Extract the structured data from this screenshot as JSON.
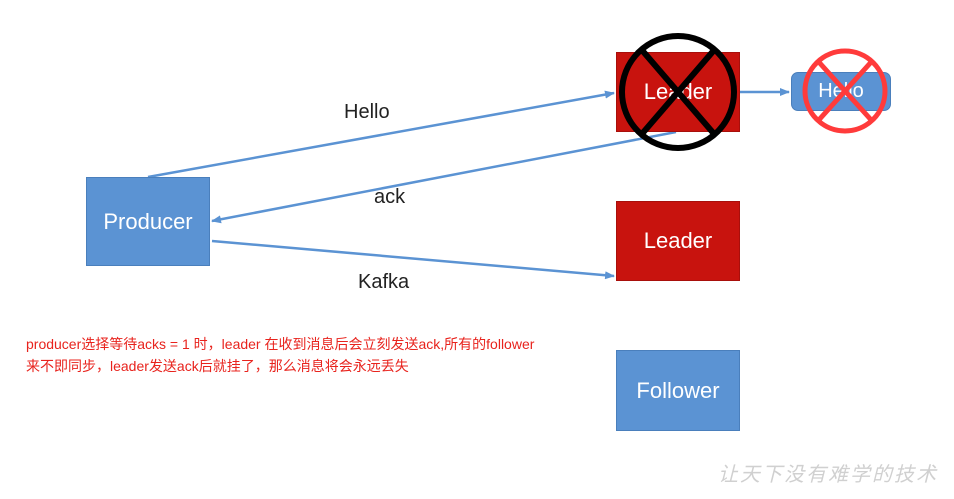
{
  "nodes": {
    "producer": "Producer",
    "leader_1": "Leader",
    "hello_box": "Hello",
    "leader_2": "Leader",
    "follower": "Follower"
  },
  "edges": {
    "hello": "Hello",
    "ack": "ack",
    "kafka": "Kafka"
  },
  "note": "producer选择等待acks = 1 时，leader 在收到消息后会立刻发送ack,所有的follower 来不即同步，leader发送ack后就挂了，那么消息将会永远丢失",
  "watermark": "让天下没有难学的技术",
  "colors": {
    "blue": "#5b93d3",
    "red": "#c8130e",
    "arrow": "#5b93d3",
    "note": "#e8231d",
    "cross_black": "#000000",
    "cross_red": "#ff3b3b"
  }
}
